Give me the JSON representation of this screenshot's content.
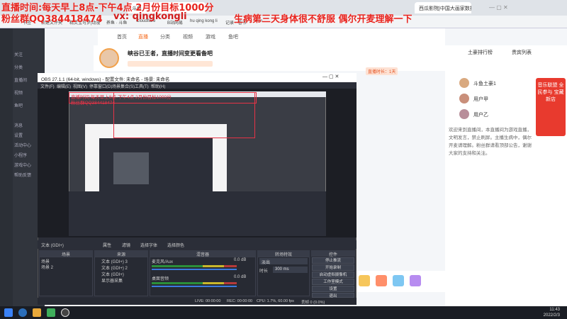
{
  "overlay": {
    "line1": "直播时间:每天早上8点-下午4点  2月份目标1000分",
    "fans": "粉丝群QQ384418474",
    "vx": "vx: qingkongli",
    "notice": "生病第三天身体很不舒服 偶尔开麦理解一下"
  },
  "browser": {
    "tab_active": "斗鱼",
    "tab_right": "西瓜影院|中国大画家数据大库",
    "bookmarks": [
      "书签",
      "新建文件夹",
      "精灵宝可梦|动漫",
      "养鱼 · 斗鱼",
      "Cloudflare",
      "B站网易",
      "hu qing kong li",
      "记录 · 看书",
      "Sam"
    ]
  },
  "site": {
    "nav": [
      "首页",
      "直播",
      "分类",
      "视频",
      "游戏",
      "鱼吧"
    ],
    "stream_title": "峡谷已王者，直播时间变更看备吧",
    "badge": "直播时长：1天",
    "side_menu": [
      "关注",
      "分类",
      "直播间",
      "视频",
      "鱼吧",
      "消息",
      "设置",
      "活动中心",
      "小程序",
      "游戏中心",
      "帮助反馈"
    ],
    "right_panel": {
      "tab_left": "土豪排行榜",
      "tab_right": "贵宾列表",
      "users": [
        "斗鱼土豪1",
        "用户甲",
        "用户乙"
      ]
    },
    "chat_text": "欢迎来到直播间，本直播间为游戏直播，文明发言，禁止刷屏。主播生病中，偶尔开麦请理解。粉丝群请看顶部公告，谢谢大家的支持和关注。",
    "ad": "音乐联盟 全民参与 宝藏新店"
  },
  "obs": {
    "title": "OBS 27.1.1 (64-bit, windows) - 配置文件: 未命名 - 场景: 未命名",
    "menu": [
      "文件(F)",
      "编辑(E)",
      "视图(V)",
      "停靠窗口(D)",
      "配置文件(P)",
      "场景集合(S)",
      "工具(T)",
      "帮助(H)"
    ],
    "source_bar": {
      "source": "文本 (GDI+)",
      "props": "属性",
      "filters": "滤镜",
      "text_btn": "选择字体",
      "edit": "选择颜色"
    },
    "docks": {
      "scenes": "场景",
      "sources": "来源",
      "mixer": "混音器",
      "transitions": "转场特效",
      "controls": "控件"
    },
    "scenes": [
      "场景",
      "场景 2"
    ],
    "sources": [
      "文本 (GDI+) 3",
      "文本 (GDI+) 2",
      "文本 (GDI+)",
      "显示器采集"
    ],
    "mixer": {
      "ch1": "麦克风/Aux",
      "ch2": "桌面音频",
      "db1": "0.0 dB",
      "db2": "0.0 dB"
    },
    "transition": {
      "type": "淡出",
      "duration_label": "时长",
      "duration": "300 ms"
    },
    "controls": [
      "停止推流",
      "开始录制",
      "启动虚拟摄像机",
      "工作室模式",
      "设置",
      "退出"
    ],
    "status": {
      "live": "LIVE: 00:00:00",
      "rec": "REC: 00:00:00",
      "cpu": "CPU: 1.7%, 60.00 fps",
      "dropped": "丢帧 0 (0.0%)"
    }
  },
  "taskbar": {
    "time": "11:43",
    "date": "2022/2/3"
  }
}
